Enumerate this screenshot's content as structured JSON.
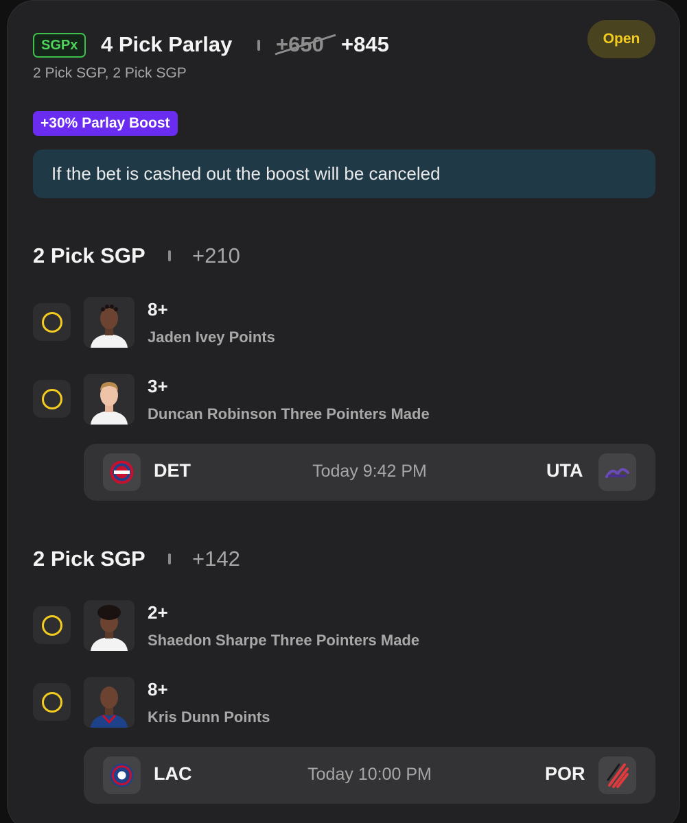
{
  "header": {
    "badge": "SGPx",
    "title": "4 Pick Parlay",
    "odds_original": "+650",
    "odds_boosted": "+845",
    "subtitle": "2 Pick SGP, 2 Pick SGP",
    "status": "Open"
  },
  "boost": {
    "label": "+30% Parlay Boost",
    "notice": "If the bet is cashed out the boost will be canceled"
  },
  "sections": [
    {
      "title": "2 Pick SGP",
      "odds": "+210",
      "picks": [
        {
          "line": "8+",
          "desc": "Jaden Ivey Points"
        },
        {
          "line": "3+",
          "desc": "Duncan Robinson Three Pointers Made"
        }
      ],
      "game": {
        "away": "DET",
        "time": "Today 9:42 PM",
        "home": "UTA"
      }
    },
    {
      "title": "2 Pick SGP",
      "odds": "+142",
      "picks": [
        {
          "line": "2+",
          "desc": "Shaedon Sharpe Three Pointers Made"
        },
        {
          "line": "8+",
          "desc": "Kris Dunn Points"
        }
      ],
      "game": {
        "away": "LAC",
        "time": "Today 10:00 PM",
        "home": "POR"
      }
    }
  ],
  "colors": {
    "sgpx_green": "#4fd35b",
    "status_yellow": "#f3cc1f",
    "boost_purple": "#6a2cf0",
    "notice_bg": "#1f3947"
  }
}
